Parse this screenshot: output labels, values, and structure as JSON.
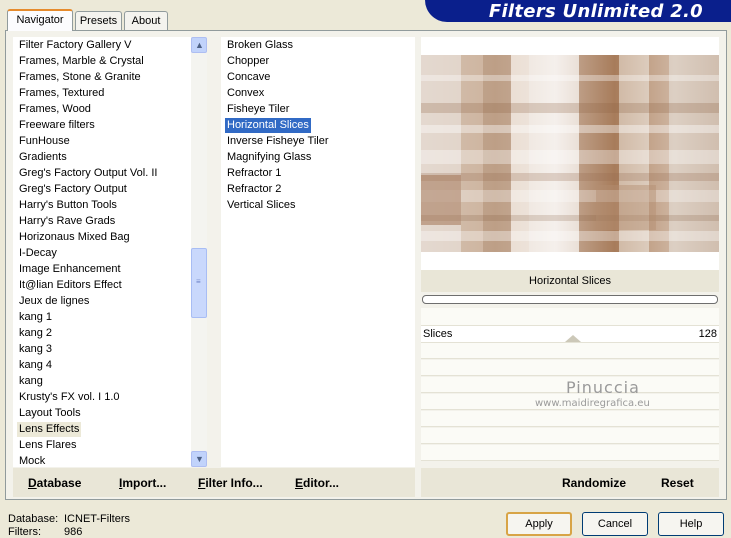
{
  "tabs": [
    {
      "label": "Navigator",
      "active": true
    },
    {
      "label": "Presets"
    },
    {
      "label": "About"
    }
  ],
  "banner_title": "Filters Unlimited 2.0",
  "categories": [
    "Filter Factory Gallery V",
    "Frames, Marble & Crystal",
    "Frames, Stone & Granite",
    "Frames, Textured",
    "Frames, Wood",
    "Freeware filters",
    "FunHouse",
    "Gradients",
    "Greg's Factory Output Vol. II",
    "Greg's Factory Output",
    "Harry's Button Tools",
    "Harry's Rave Grads",
    "Horizonaus Mixed Bag",
    "I-Decay",
    "Image Enhancement",
    "It@lian Editors Effect",
    "Jeux de lignes",
    "kang 1",
    "kang 2",
    "kang 3",
    "kang 4",
    "kang",
    "Krusty's FX vol. I 1.0",
    "Layout Tools",
    "Lens Effects",
    "Lens Flares",
    "Mock"
  ],
  "selected_category": "Lens Effects",
  "filters": [
    "Broken Glass",
    "Chopper",
    "Concave",
    "Convex",
    "Fisheye Tiler",
    "Horizontal Slices",
    "Inverse Fisheye Tiler",
    "Magnifying Glass",
    "Refractor 1",
    "Refractor 2",
    "Vertical Slices"
  ],
  "selected_filter": "Horizontal Slices",
  "toolbar": {
    "database": "Database",
    "import": "Import...",
    "filter_info": "Filter Info...",
    "editor": "Editor...",
    "randomize": "Randomize",
    "reset": "Reset"
  },
  "current_filter_name": "Horizontal Slices",
  "slider": {
    "label": "Slices",
    "value": "128"
  },
  "watermark": {
    "name": "Pinuccia",
    "url": "www.maidiregrafica.eu"
  },
  "footer": {
    "database_label": "Database:",
    "database_value": "ICNET-Filters",
    "filters_label": "Filters:",
    "filters_value": "986"
  },
  "buttons": {
    "apply": "Apply",
    "cancel": "Cancel",
    "help": "Help"
  },
  "colors": {
    "banner": "#0a1f8c",
    "selection": "#316ac5",
    "active_tab_accent": "#e68b2c"
  }
}
